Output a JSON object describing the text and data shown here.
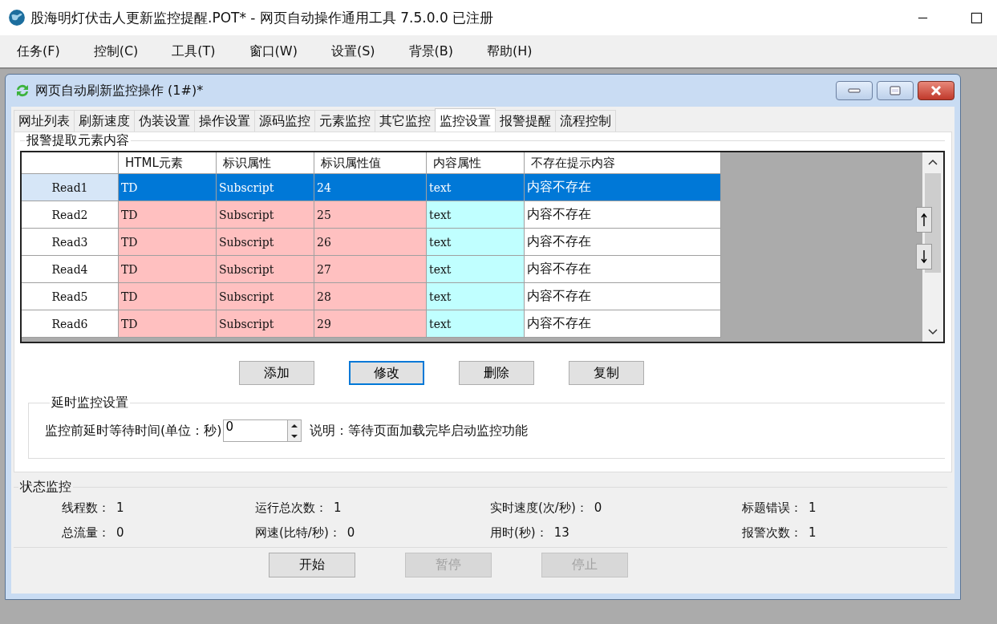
{
  "window": {
    "title": "股海明灯伏击人更新监控提醒.POT* - 网页自动操作通用工具 7.5.0.0  已注册"
  },
  "menu": [
    {
      "label": "任务(F)"
    },
    {
      "label": "控制(C)"
    },
    {
      "label": "工具(T)"
    },
    {
      "label": "窗口(W)"
    },
    {
      "label": "设置(S)"
    },
    {
      "label": "背景(B)"
    },
    {
      "label": "帮助(H)"
    }
  ],
  "child_window": {
    "title": "网页自动刷新监控操作  (1#)*"
  },
  "tabs": [
    {
      "label": "网址列表",
      "selected": false
    },
    {
      "label": "刷新速度",
      "selected": false
    },
    {
      "label": "伪装设置",
      "selected": false
    },
    {
      "label": "操作设置",
      "selected": false
    },
    {
      "label": "源码监控",
      "selected": false
    },
    {
      "label": "元素监控",
      "selected": false
    },
    {
      "label": "其它监控",
      "selected": false
    },
    {
      "label": "监控设置",
      "selected": true
    },
    {
      "label": "报警提醒",
      "selected": false
    },
    {
      "label": "流程控制",
      "selected": false
    }
  ],
  "alert_group": {
    "title": "报警提取元素内容",
    "columns": [
      {
        "label": "HTML元素",
        "color": "#ffc0c0"
      },
      {
        "label": "标识属性",
        "color": "#ffc0c0"
      },
      {
        "label": "标识属性值",
        "color": "#ffc0c0"
      },
      {
        "label": "内容属性",
        "color": "#c0ffff"
      },
      {
        "label": "不存在提示内容",
        "color": "#ffffff"
      }
    ],
    "rows": [
      {
        "header": "Read1",
        "selected": true,
        "cells": [
          "TD",
          "Subscript",
          "24",
          "text",
          "内容不存在"
        ]
      },
      {
        "header": "Read2",
        "selected": false,
        "cells": [
          "TD",
          "Subscript",
          "25",
          "text",
          "内容不存在"
        ]
      },
      {
        "header": "Read3",
        "selected": false,
        "cells": [
          "TD",
          "Subscript",
          "26",
          "text",
          "内容不存在"
        ]
      },
      {
        "header": "Read4",
        "selected": false,
        "cells": [
          "TD",
          "Subscript",
          "27",
          "text",
          "内容不存在"
        ]
      },
      {
        "header": "Read5",
        "selected": false,
        "cells": [
          "TD",
          "Subscript",
          "28",
          "text",
          "内容不存在"
        ]
      },
      {
        "header": "Read6",
        "selected": false,
        "cells": [
          "TD",
          "Subscript",
          "29",
          "text",
          "内容不存在"
        ]
      }
    ]
  },
  "row_buttons": [
    {
      "label": "添加",
      "focused": false
    },
    {
      "label": "修改",
      "focused": true
    },
    {
      "label": "删除",
      "focused": false
    },
    {
      "label": "复制",
      "focused": false
    }
  ],
  "delay_group": {
    "title": "延时监控设置",
    "label": "监控前延时等待时间(单位：秒)",
    "value": "0",
    "note": "说明：等待页面加载完毕启动监控功能"
  },
  "status_group": {
    "title": "状态监控",
    "stats": [
      {
        "label": "线程数：",
        "value": "1"
      },
      {
        "label": "运行总次数：",
        "value": "1"
      },
      {
        "label": "实时速度(次/秒)：",
        "value": "0"
      },
      {
        "label": "标题错误：",
        "value": "1"
      },
      {
        "label": "总流量：",
        "value": "0"
      },
      {
        "label": "网速(比特/秒)：",
        "value": "0"
      },
      {
        "label": "用时(秒)：",
        "value": "13"
      },
      {
        "label": "报警次数：",
        "value": "1"
      }
    ]
  },
  "control_buttons": [
    {
      "label": "开始",
      "disabled": false
    },
    {
      "label": "暂停",
      "disabled": true
    },
    {
      "label": "停止",
      "disabled": true
    }
  ]
}
